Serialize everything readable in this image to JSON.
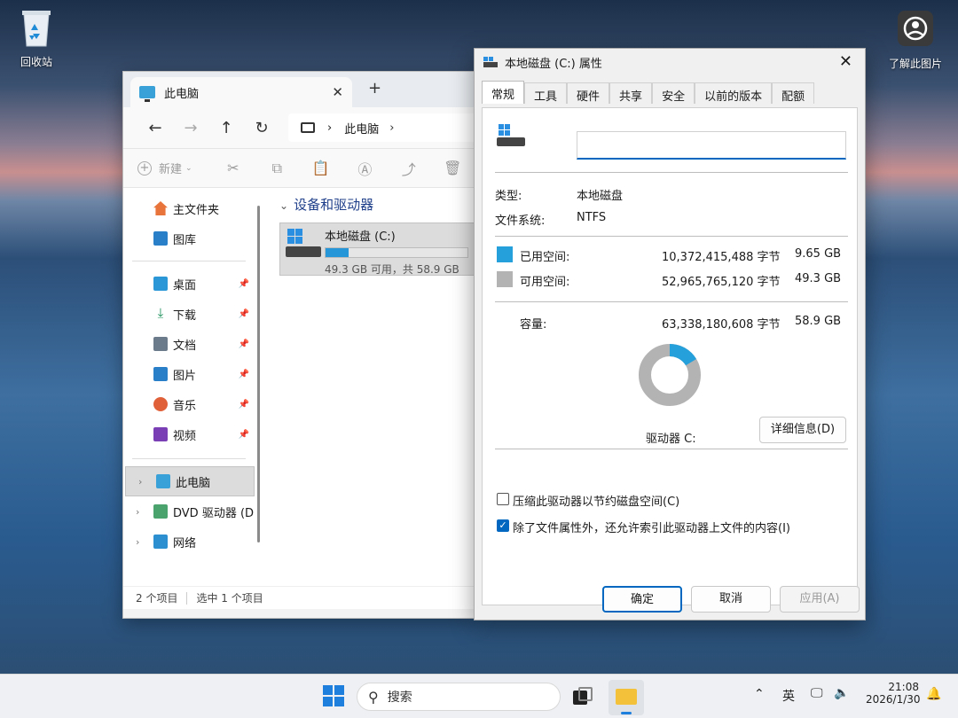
{
  "desktop": {
    "recycle_bin": "回收站",
    "learn_picture": "了解此图片"
  },
  "explorer": {
    "tab_title": "此电脑",
    "tab_close": "✕",
    "new_tab": "+",
    "address": {
      "root_chevron": "›",
      "location": "此电脑",
      "trail_chevron": "›"
    },
    "command_bar": {
      "new_label": "新建"
    },
    "sidebar": {
      "quick": [
        {
          "label": "主文件夹"
        },
        {
          "label": "图库"
        }
      ],
      "pinned": [
        {
          "label": "桌面"
        },
        {
          "label": "下载"
        },
        {
          "label": "文档"
        },
        {
          "label": "图片"
        },
        {
          "label": "音乐"
        },
        {
          "label": "视频"
        }
      ],
      "locations": [
        {
          "label": "此电脑"
        },
        {
          "label": "DVD 驱动器 (D"
        },
        {
          "label": "网络"
        }
      ]
    },
    "content": {
      "group_header": "设备和驱动器",
      "drive": {
        "name": "本地磁盘 (C:)",
        "usage_fraction": 0.164,
        "free_text": "49.3 GB 可用，共 58.9 GB"
      }
    },
    "status": {
      "item_count": "2 个项目",
      "selected": "选中 1 个项目"
    }
  },
  "properties": {
    "title": "本地磁盘 (C:) 属性",
    "tabs": [
      "常规",
      "工具",
      "硬件",
      "共享",
      "安全",
      "以前的版本",
      "配额"
    ],
    "active_tab": "常规",
    "volume_label_value": "",
    "type_label": "类型:",
    "type_value": "本地磁盘",
    "fs_label": "文件系统:",
    "fs_value": "NTFS",
    "used_label": "已用空间:",
    "used_bytes": "10,372,415,488 字节",
    "used_gb": "9.65 GB",
    "free_label": "可用空间:",
    "free_bytes": "52,965,765,120 字节",
    "free_gb": "49.3 GB",
    "capacity_label": "容量:",
    "capacity_bytes": "63,338,180,608 字节",
    "capacity_gb": "58.9 GB",
    "used_fraction": 0.164,
    "drive_label": "驱动器 C:",
    "details_button": "详细信息(D)",
    "compress_label": "压缩此驱动器以节约磁盘空间(C)",
    "compress_checked": false,
    "index_label": "除了文件属性外，还允许索引此驱动器上文件的内容(I)",
    "index_checked": true,
    "ok": "确定",
    "cancel": "取消",
    "apply": "应用(A)",
    "colors": {
      "used": "#26a0da",
      "free": "#b3b3b3"
    }
  },
  "taskbar": {
    "search_placeholder": "搜索",
    "ime": "英",
    "time": "21:08",
    "date": "2026/1/30"
  }
}
